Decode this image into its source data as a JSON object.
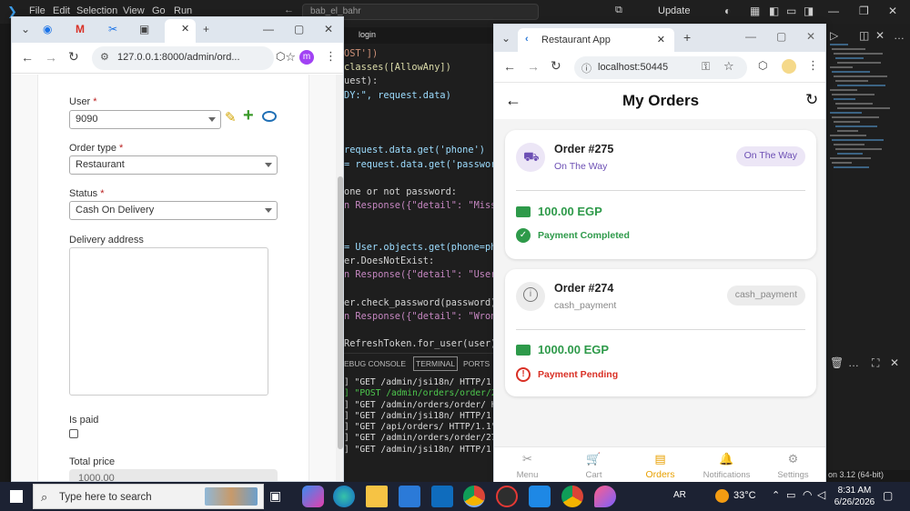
{
  "vscode": {
    "menu": [
      "File",
      "Edit",
      "Selection",
      "View",
      "Go",
      "Run"
    ],
    "search_text": "bab_el_bahr",
    "update_label": "Update",
    "editor_tab_label": "login",
    "code_lines": [
      "OST'])",
      "classes([AllowAny])",
      "uest):",
      "DY:\", request.data)",
      "",
      "",
      "",
      "request.data.get('phone')",
      "= request.data.get('password')",
      "",
      "one or not password:",
      "n Response({\"detail\": \"Missin",
      "",
      "",
      "= User.objects.get(phone=phone",
      "er.DoesNotExist:",
      "n Response({\"detail\": \"User n",
      "",
      "er.check_password(password):",
      "n Response({\"detail\": \"Wrong",
      "",
      "RefreshToken.for_user(user)"
    ],
    "panel_tabs": [
      "EBUG CONSOLE",
      "TERMINAL",
      "PORTS"
    ],
    "terminal_lines": [
      "] \"GET /admin/jsi18n/ HTTP/1.1\"",
      "] \"POST /admin/orders/order/275/",
      "] \"GET /admin/orders/order/ HTTP",
      "] \"GET /admin/jsi18n/ HTTP/1.1\"",
      "] \"GET /api/orders/ HTTP/1.1\" 20",
      "] \"GET /admin/orders/order/274/c",
      "] \"GET /admin/jsi18n/ HTTP/1.1\""
    ],
    "status_text": "on 3.12 (64-bit)"
  },
  "admin_browser": {
    "url": "127.0.0.1:8000/admin/ord...",
    "profile_initial": "m",
    "fields": {
      "user_label": "User",
      "user_value": "9090",
      "order_type_label": "Order type",
      "order_type_value": "Restaurant",
      "status_label": "Status",
      "status_value": "Cash On Delivery",
      "delivery_label": "Delivery address",
      "is_paid_label": "Is paid",
      "total_price_label": "Total price",
      "total_price_value": "1000.00"
    },
    "required_mark": "*"
  },
  "restaurant_browser": {
    "tab_title": "Restaurant App",
    "url": "localhost:50445",
    "page_title": "My Orders",
    "orders": [
      {
        "number": "Order #275",
        "sub": "On The Way",
        "pill": "On The Way",
        "price": "100.00 EGP",
        "payment": "Payment Completed"
      },
      {
        "number": "Order #274",
        "sub": "cash_payment",
        "pill": "cash_payment",
        "price": "1000.00 EGP",
        "payment": "Payment Pending"
      }
    ],
    "nav": [
      "Menu",
      "Cart",
      "Orders",
      "Notifications",
      "Settings"
    ],
    "active_nav": "Orders"
  },
  "colors": {
    "accent_purple": "#6c4fb4",
    "pill_purple_bg": "#ece6f6",
    "green": "#2e9a4a",
    "red": "#d93025",
    "orange_active": "#e8a000",
    "grey_pill_bg": "#ececec"
  },
  "taskbar": {
    "search_placeholder": "Type here to search",
    "lang": "AR",
    "temperature": "33°C",
    "time": "8:31 AM",
    "date": "6/26/2026"
  }
}
